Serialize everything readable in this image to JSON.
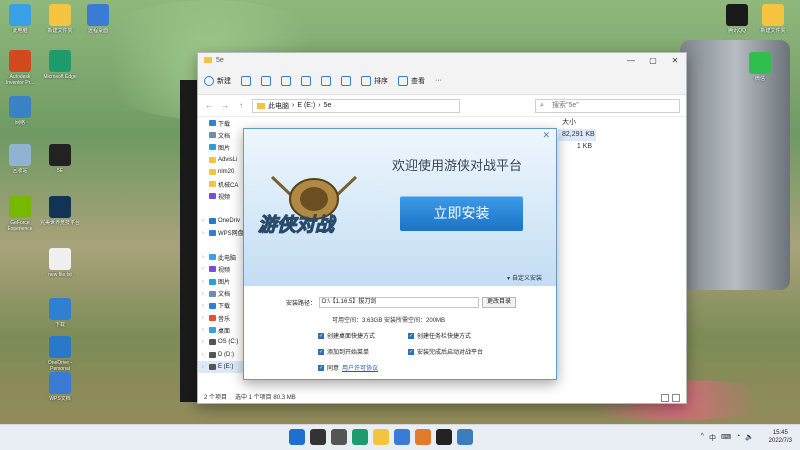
{
  "desktop": {
    "left_icons": [
      {
        "label": "此电脑",
        "color": "#3aa0e6"
      },
      {
        "label": "新建文件夹",
        "color": "#f5c542"
      },
      {
        "label": "远程桌面",
        "color": "#3a7bd5"
      },
      {
        "label": "Autodesk Inventor Pr...",
        "color": "#d04a1e"
      },
      {
        "label": "Microsoft Edge",
        "color": "#1e9a6f"
      },
      {
        "label": "网络",
        "color": "#3b82c4"
      },
      {
        "label": "回收站",
        "color": "#8fb3d0"
      },
      {
        "label": "5E",
        "color": "#222222"
      },
      {
        "label": "GeForce Experience",
        "color": "#76b900"
      },
      {
        "label": "完美世界竞技平台",
        "color": "#113355"
      },
      {
        "label": "new file.txt",
        "color": "#f0f0f0"
      },
      {
        "label": "下载",
        "color": "#2f80d0"
      },
      {
        "label": "OneDrive - Personal",
        "color": "#2a78c8"
      },
      {
        "label": "WPS文档",
        "color": "#3a7bd5"
      }
    ],
    "right_icons": [
      {
        "label": "腾讯QQ",
        "color": "#1a1a1a"
      },
      {
        "label": "新建文件夹",
        "color": "#f5c542"
      },
      {
        "label": "微信",
        "color": "#2fbf4f"
      }
    ]
  },
  "explorer": {
    "title": "5e",
    "toolbar": {
      "new_label": "新建",
      "sort_label": "排序",
      "view_label": "查看",
      "more": "···"
    },
    "window_buttons": [
      "—",
      "▢",
      "✕"
    ],
    "nav": [
      "←",
      "→",
      "↑"
    ],
    "breadcrumb": [
      "此电脑",
      "E (E:)",
      "5e"
    ],
    "search_placeholder": "搜索\"5e\"",
    "sidebar": [
      {
        "label": "下载",
        "color": "#2f80d0",
        "indent": false
      },
      {
        "label": "文档",
        "color": "#6d8db3",
        "indent": false
      },
      {
        "label": "图片",
        "color": "#2d9cdb",
        "indent": false
      },
      {
        "label": "AdvisLi",
        "color": "#f5c542",
        "indent": false
      },
      {
        "label": "nlm20",
        "color": "#f5c542",
        "indent": false
      },
      {
        "label": "机械CA",
        "color": "#f5c542",
        "indent": false
      },
      {
        "label": "视频",
        "color": "#7b4dd6",
        "indent": false
      },
      {
        "label": "",
        "color": "",
        "indent": false
      },
      {
        "label": "OneDriv",
        "color": "#2a78c8",
        "indent": true
      },
      {
        "label": "WPS网盘",
        "color": "#3a7bd5",
        "indent": true
      },
      {
        "label": "",
        "color": "",
        "indent": false
      },
      {
        "label": "此电脑",
        "color": "#3aa0e6",
        "indent": true
      },
      {
        "label": "视频",
        "color": "#7b4dd6",
        "indent": true
      },
      {
        "label": "图片",
        "color": "#2d9cdb",
        "indent": true
      },
      {
        "label": "文档",
        "color": "#6d8db3",
        "indent": true
      },
      {
        "label": "下载",
        "color": "#2f80d0",
        "indent": true
      },
      {
        "label": "音乐",
        "color": "#e0503a",
        "indent": true
      },
      {
        "label": "桌面",
        "color": "#3aa0e6",
        "indent": true
      },
      {
        "label": "OS (C:)",
        "color": "#555555",
        "indent": true
      },
      {
        "label": "D (D:)",
        "color": "#555555",
        "indent": true
      },
      {
        "label": "E (E:)",
        "color": "#555555",
        "indent": true
      }
    ],
    "sizes": [
      "大小",
      "82,291 KB",
      "1 KB"
    ],
    "status": {
      "count": "2 个项目",
      "selected": "选中 1 个项目 80.3 MB"
    }
  },
  "installer": {
    "close": "✕",
    "logo_text": "游侠对战",
    "welcome": "欢迎使用游侠对战平台",
    "install_button": "立即安装",
    "custom_install": "自定义安装",
    "path_label": "安装路径：",
    "path_value": "D:\\【1.16.5】拔刀剑",
    "change_dir": "更改目录",
    "space": "可用空间：3.63GB  安装所需空间：200MB",
    "options": [
      {
        "label": "创建桌面快捷方式",
        "checked": true
      },
      {
        "label": "创建任务栏快捷方式",
        "checked": true
      },
      {
        "label": "添加到开始菜单",
        "checked": true
      },
      {
        "label": "安装完成后启动对战平台",
        "checked": true
      }
    ],
    "agree_prefix": "同意",
    "agree_link": "用户许可协议"
  },
  "taskbar": {
    "icons": [
      {
        "name": "start-icon",
        "color": "#1e6fd0"
      },
      {
        "name": "search-icon",
        "color": "#333333"
      },
      {
        "name": "task-view-icon",
        "color": "#555555"
      },
      {
        "name": "edge-icon",
        "color": "#1e9a6f"
      },
      {
        "name": "explorer-icon",
        "color": "#f5c542"
      },
      {
        "name": "app-icon",
        "color": "#3a7bd5"
      },
      {
        "name": "game-platform-icon",
        "color": "#e07a2e"
      },
      {
        "name": "5e-icon",
        "color": "#222222"
      },
      {
        "name": "installer-icon",
        "color": "#3b7dbd"
      }
    ],
    "tray": [
      "^",
      "中",
      "⌨",
      "◔",
      "🔈"
    ],
    "time": "15:45",
    "date": "2022/7/3"
  }
}
